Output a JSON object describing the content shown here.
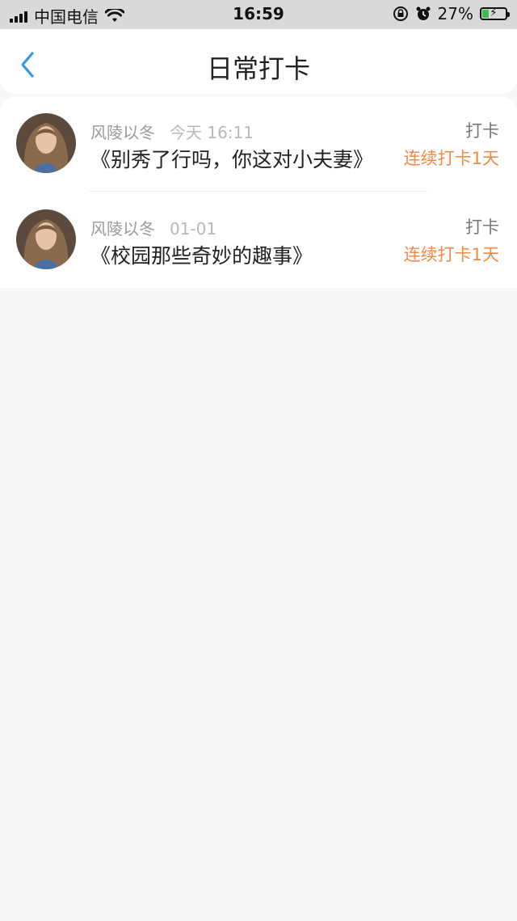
{
  "status_bar": {
    "carrier": "中国电信",
    "time": "16:59",
    "battery_percent": "27%",
    "icons": [
      "signal-icon",
      "wifi-icon",
      "orientation-lock-icon",
      "alarm-icon",
      "battery-icon"
    ],
    "battery_level": 0.27
  },
  "header": {
    "title": "日常打卡",
    "back_icon": "chevron-left-icon",
    "accent_color": "#2d9be6"
  },
  "records": [
    {
      "user": "风陵以冬",
      "time": "今天 16:11",
      "title": "《别秀了行吗，你这对小夫妻》",
      "action_label": "打卡",
      "streak": "连续打卡1天"
    },
    {
      "user": "风陵以冬",
      "time": "01-01",
      "title": "《校园那些奇妙的趣事》",
      "action_label": "打卡",
      "streak": "连续打卡1天"
    }
  ],
  "colors": {
    "streak": "#f08a47",
    "background": "#f8f6f7"
  }
}
